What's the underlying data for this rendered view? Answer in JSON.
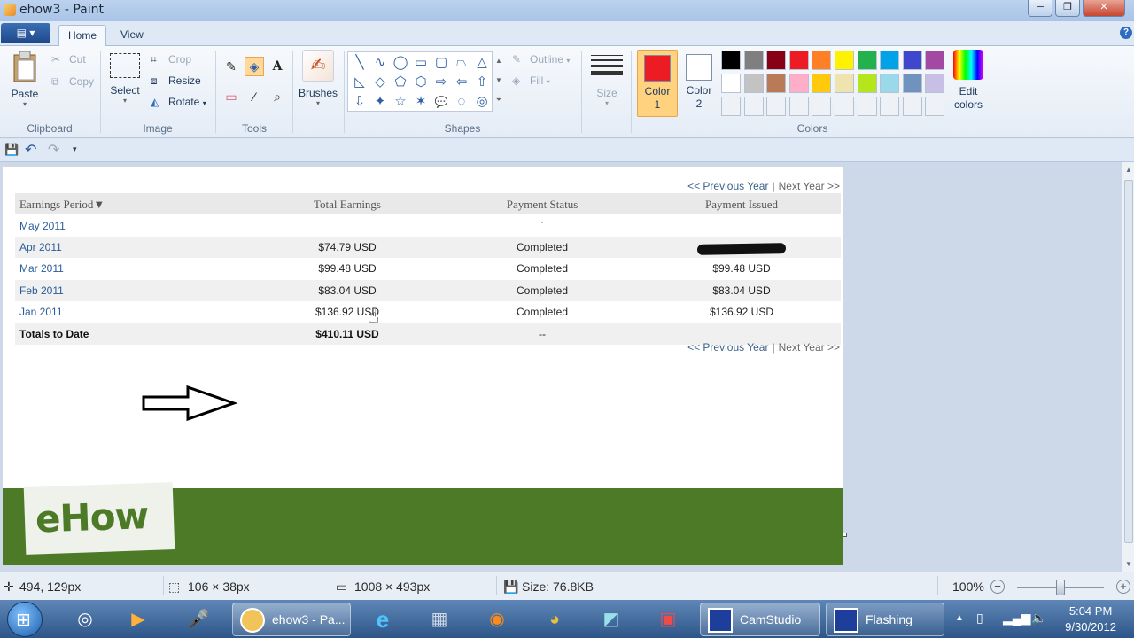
{
  "window": {
    "title": "ehow3 - Paint",
    "min": "─",
    "max": "❐",
    "close": "✕"
  },
  "ribbon_tabs": {
    "menu": "▤ ▾",
    "home": "Home",
    "view": "View",
    "help": "?"
  },
  "clipboard": {
    "paste": "Paste",
    "cut": "Cut",
    "copy": "Copy",
    "group": "Clipboard"
  },
  "image": {
    "select": "Select",
    "crop": "Crop",
    "resize": "Resize",
    "rotate": "Rotate",
    "group": "Image"
  },
  "tools": {
    "group": "Tools",
    "pencil": "✎",
    "fill": "◈",
    "text": "A",
    "eraser": "▭",
    "picker": "⁄",
    "magnifier": "⌕"
  },
  "brushes": {
    "label": "Brushes"
  },
  "shapes": {
    "group": "Shapes",
    "outline": "Outline",
    "fill": "Fill",
    "glyphs": [
      "╲",
      "∿",
      "◯",
      "▭",
      "▢",
      "⏢",
      "△",
      "◺",
      "◇",
      "⬠",
      "⬡",
      "⇨",
      "⇦",
      "⇧",
      "⇩",
      "✦",
      "☆",
      "✶",
      "💬",
      "◌",
      "◎"
    ]
  },
  "size": {
    "label": "Size"
  },
  "colors": {
    "group": "Colors",
    "color1_label": "Color 1",
    "color2_label": "Color 2",
    "color1": "#ed1c24",
    "color2": "#ffffff",
    "edit_label": "Edit colors",
    "palette": [
      "#000000",
      "#7f7f7f",
      "#880015",
      "#ed1c24",
      "#ff7f27",
      "#fff200",
      "#22b14c",
      "#00a2e8",
      "#3f48cc",
      "#a349a4",
      "#ffffff",
      "#c3c3c3",
      "#b97a57",
      "#ffaec9",
      "#ffc90e",
      "#efe4b0",
      "#b5e61d",
      "#99d9ea",
      "#7092be",
      "#c8bfe7"
    ]
  },
  "qat": {
    "save": "💾",
    "undo": "↶",
    "redo": "↷",
    "more": "▾"
  },
  "canvas": {
    "prev_year": "<< Previous Year",
    "next_year": "Next Year >>",
    "separator": "|",
    "headers": {
      "period": "Earnings Period▼",
      "total": "Total Earnings",
      "status": "Payment Status",
      "issued": "Payment Issued"
    },
    "rows": [
      {
        "period": "May 2011",
        "total": "",
        "status": "·",
        "issued": ""
      },
      {
        "period": "Apr 2011",
        "total": "$74.79 USD",
        "status": "Completed",
        "issued": ""
      },
      {
        "period": "Mar 2011",
        "total": "$99.48 USD",
        "status": "Completed",
        "issued": "$99.48 USD"
      },
      {
        "period": "Feb 2011",
        "total": "$83.04 USD",
        "status": "Completed",
        "issued": "$83.04 USD"
      },
      {
        "period": "Jan 2011",
        "total": "$136.92 USD",
        "status": "Completed",
        "issued": "$136.92 USD"
      }
    ],
    "totals": {
      "label": "Totals to Date",
      "total": "$410.11 USD",
      "status": "--"
    },
    "logo": "eHow"
  },
  "statusbar": {
    "cursor_pos": "494, 129px",
    "selection_size": "106 × 38px",
    "image_size": "1008 × 493px",
    "file_size": "Size: 76.8KB",
    "zoom": "100%",
    "zoom_out": "−",
    "zoom_in": "+"
  },
  "taskbar": {
    "start": "⊞",
    "tasks": {
      "paint": "ehow3 - Pa...",
      "camstudio": "CamStudio",
      "flashing": "Flashing"
    },
    "tray": {
      "show_hidden": "▲",
      "time": "5:04 PM",
      "date": "9/30/2012"
    }
  }
}
